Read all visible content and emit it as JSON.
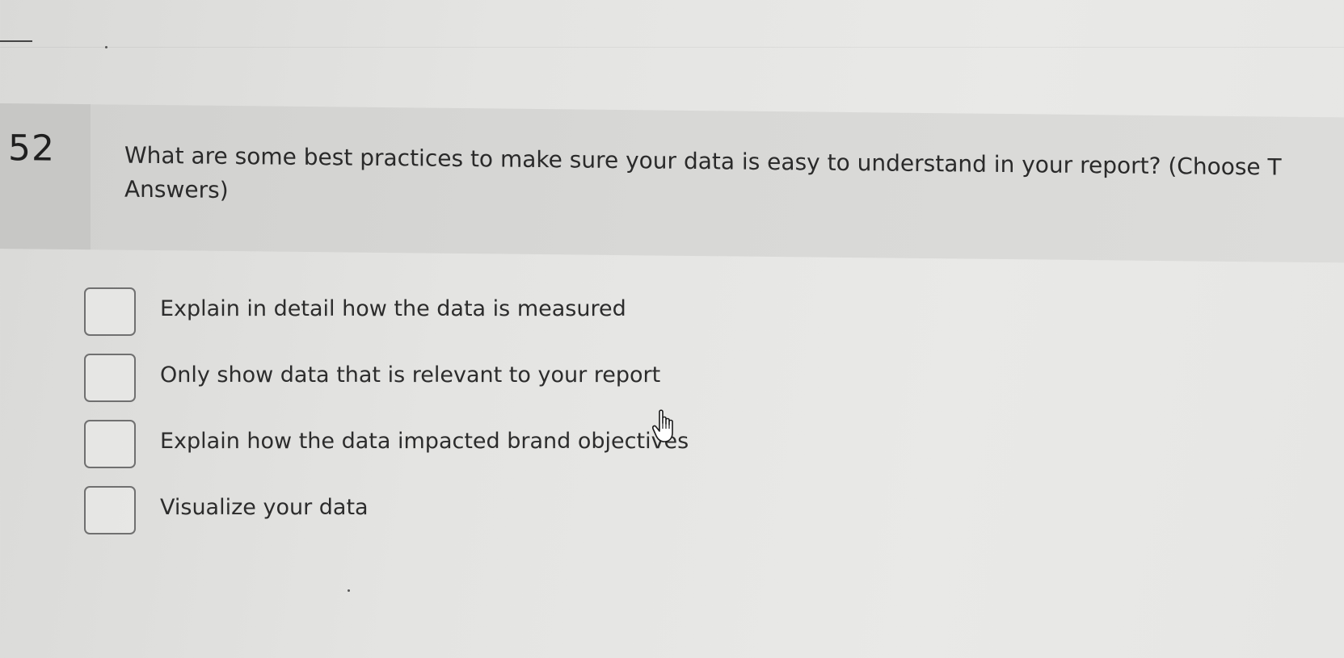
{
  "question": {
    "number": "52",
    "text_line1": "What are some best practices to make sure your data is easy to understand in your report? (Choose T",
    "text_line2": "Answers)"
  },
  "options": [
    {
      "label": "Explain in detail how the data is measured",
      "checked": false
    },
    {
      "label": "Only show data that is relevant to your report",
      "checked": false
    },
    {
      "label": "Explain how the data impacted brand objectives",
      "checked": false
    },
    {
      "label": "Visualize your data",
      "checked": false
    }
  ],
  "cursor": {
    "icon": "hand-pointer-icon"
  },
  "colors": {
    "background": "#e4e4e2",
    "question_band": "#d8d8d6",
    "number_cell": "#c7c7c5",
    "checkbox_border": "#707070",
    "text": "#2b2b2b"
  }
}
